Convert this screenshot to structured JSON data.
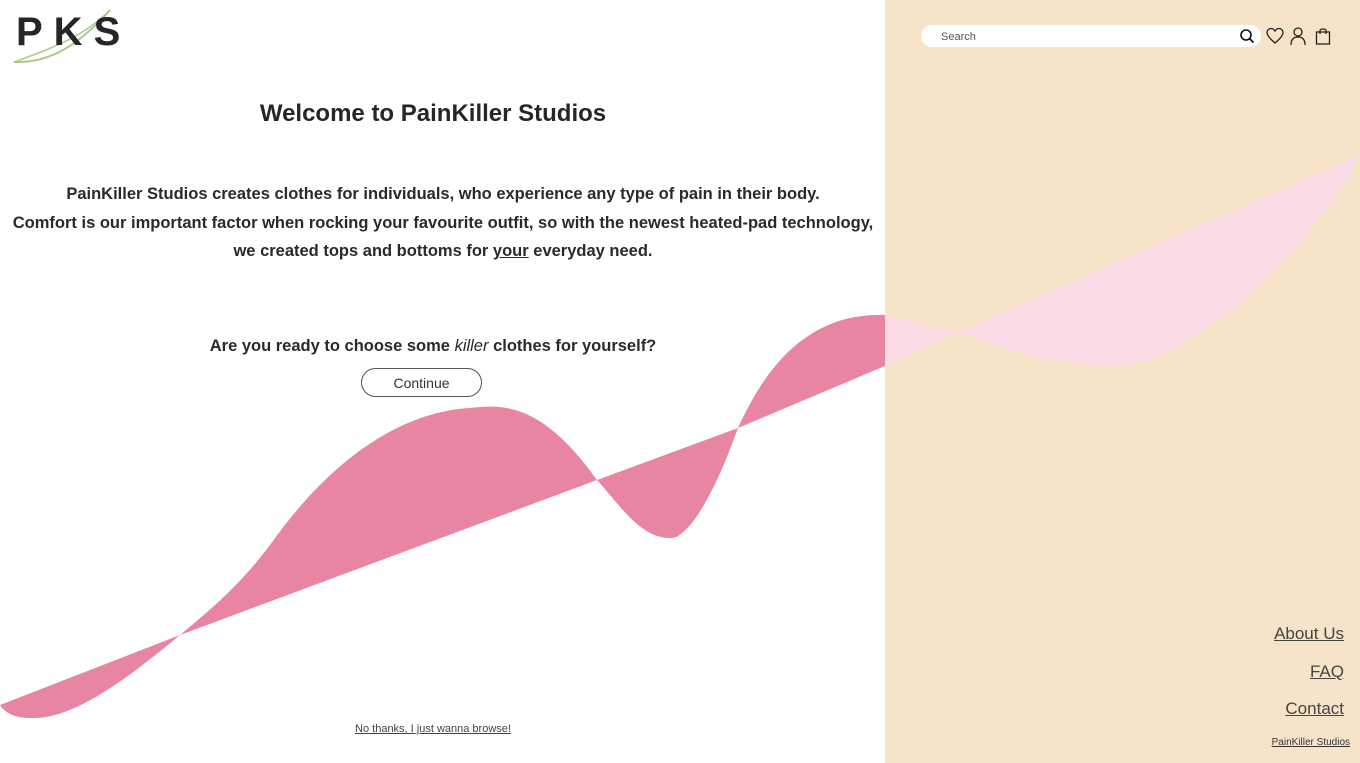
{
  "brand": {
    "logo_text": "PKS",
    "footer_name": "PainKiller Studios"
  },
  "colors": {
    "right_panel": "#f6e4c8",
    "wave_pink": "#e886a2",
    "wave_light_pink": "#fbdbe5",
    "logo_swoosh": "#a8c98a",
    "text": "#262626"
  },
  "header": {
    "search_placeholder": "Search",
    "icons": [
      "search-icon",
      "heart-icon",
      "user-icon",
      "shopping-bag-icon"
    ]
  },
  "main": {
    "title": "Welcome to PainKiller Studios",
    "intro_line1": "PainKiller Studios creates clothes for individuals, who experience any type of pain in their body.",
    "intro_line2": "Comfort is our important factor when rocking your favourite outfit, so with the newest heated-pad technology,",
    "intro_line3_before": "we created tops and bottoms for ",
    "intro_line3_underlined": "your",
    "intro_line3_after": " everyday need.",
    "question_before": "Are you ready to choose some ",
    "question_emphasis": "killer",
    "question_after": " clothes for yourself?",
    "continue_label": "Continue",
    "browse_link": "No thanks, I just wanna browse!"
  },
  "sidebar_nav": {
    "about": "About Us",
    "faq": "FAQ",
    "contact": "Contact"
  }
}
